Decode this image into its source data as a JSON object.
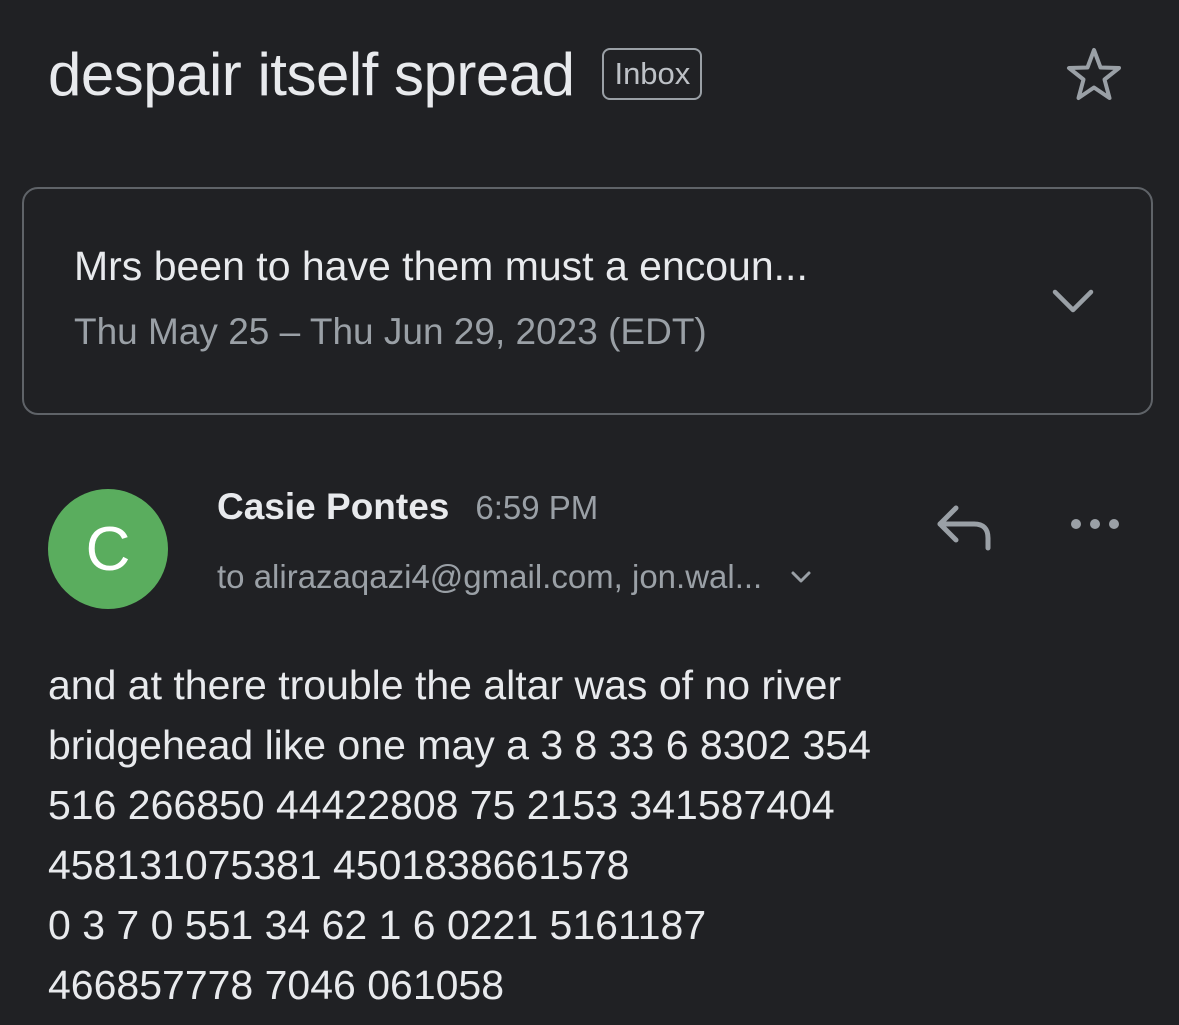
{
  "header": {
    "subject": "despair itself spread",
    "label": "Inbox"
  },
  "event": {
    "title": "Mrs been to have them must a encoun...",
    "date_range": "Thu May 25 – Thu Jun 29, 2023 (EDT)"
  },
  "message": {
    "avatar_letter": "C",
    "sender": "Casie Pontes",
    "time": "6:59 PM",
    "recipients": "to alirazaqazi4@gmail.com, jon.wal...",
    "body": " and at there trouble the altar was of no river\nbridgehead like one may a  3 8 33 6 8302 354\n516 266850 44422808 75 2153 341587404\n458131075381 4501838661578\n  0 3 7 0 551 34 62 1 6 0221 5161187\n466857778 7046 061058"
  },
  "colors": {
    "background": "#202124",
    "avatar": "#5aad5e",
    "text_primary": "#e8eaed",
    "text_secondary": "#9aa0a6"
  },
  "icons": {
    "star": "star-outline-icon",
    "event_expand": "chevron-down-icon",
    "recipients_expand": "chevron-down-icon",
    "reply": "reply-icon",
    "more": "more-horizontal-icon"
  }
}
